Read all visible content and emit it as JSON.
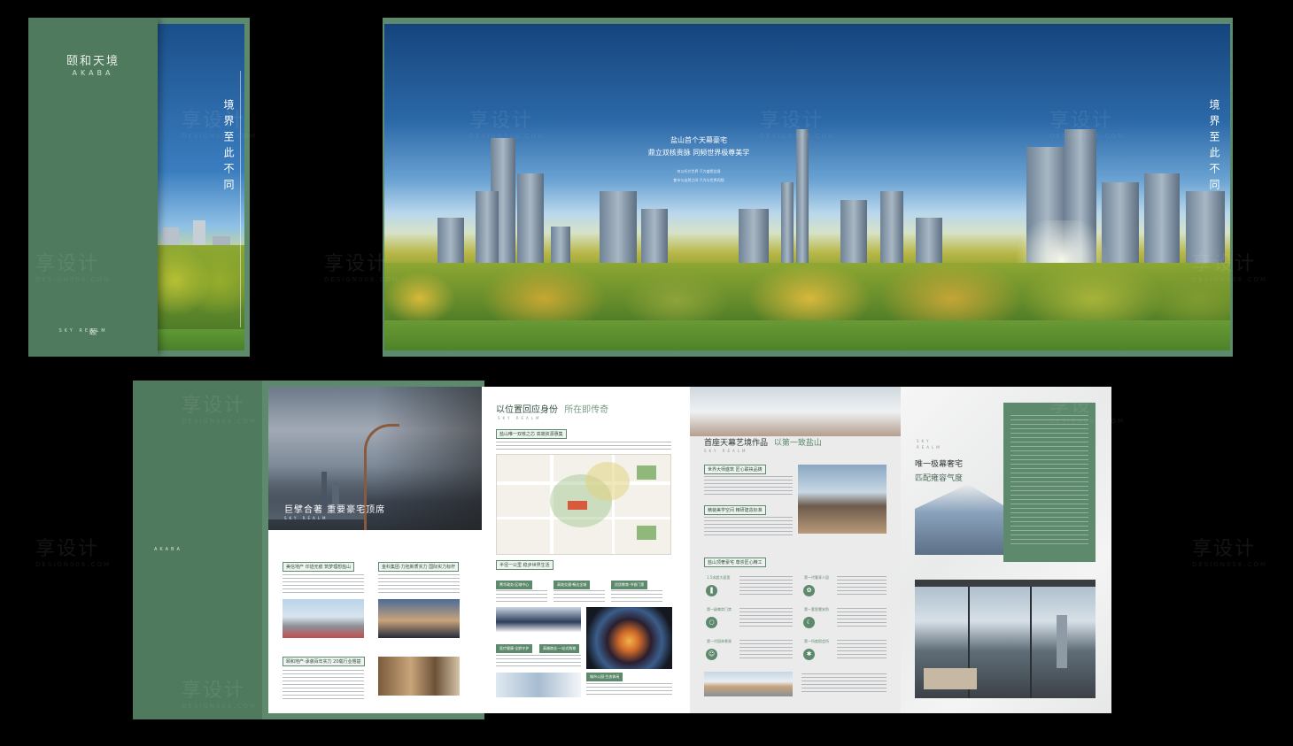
{
  "cover": {
    "logo_cn": "颐和天境",
    "logo_en": "AKABA",
    "mark": "颐",
    "footer_en": "SKY REALM",
    "vertical_text": "境界至此不同"
  },
  "banner": {
    "title": "盐山首个天幕豪宅",
    "subtitle": "鼎立双核贵脉 同频世界极尊美学",
    "lines": [
      "何以托付世界 只为盛赞此境",
      "都市与自然之间 只为与世界同频"
    ],
    "vertical_text": "境界至此不同"
  },
  "lower": {
    "flap_text": "AKABA"
  },
  "page1": {
    "headline": "巨擘合著 重要豪宅顶席",
    "headline_en": "SKY REALM",
    "tags": [
      "美信地产 印迹无痕 筑梦理想盐山",
      "金科集团·力拓新质实力 国际实力标杆",
      "颐和地产·承袭百年实力 20载行业翘楚"
    ]
  },
  "page2": {
    "title": "以位置回应身份",
    "title_accent": "所在即传奇",
    "title_en": "SKY REALM",
    "tag_map": "盐山唯一双核之芯 高端资源惠集",
    "tag_life": "半径一公里 稳步世界生活",
    "tags_small": [
      "菁华政务·区域中心",
      "高效交通·畅达全城",
      "优质教育·书香门第",
      "医疗健康·全龄守护",
      "高端商业·一站式购物",
      "城市公园·生态休闲"
    ]
  },
  "page3": {
    "title": "首座天幕艺境作品",
    "title_accent": "以第一致盐山",
    "title_en": "SKY REALM",
    "tags": [
      "世界大师盛筑 匠心联袂品铸",
      "精装美学空间 精研建造标准",
      "盐山顶奢豪宅 尊崇匠心精工"
    ],
    "icon_tags": [
      "1.5米超大面宽",
      "第一代奢享人居",
      "第一级尊崇门禁",
      "第一套智慧安防",
      "第一代园林景观",
      "第一所度假会所"
    ]
  },
  "page4": {
    "title": "唯一极幕奢宅",
    "subtitle": "匹配雍容气度",
    "title_en": "SKY REALM"
  },
  "watermark": {
    "cn": "享设计",
    "en": "DESIGN006.COM"
  }
}
